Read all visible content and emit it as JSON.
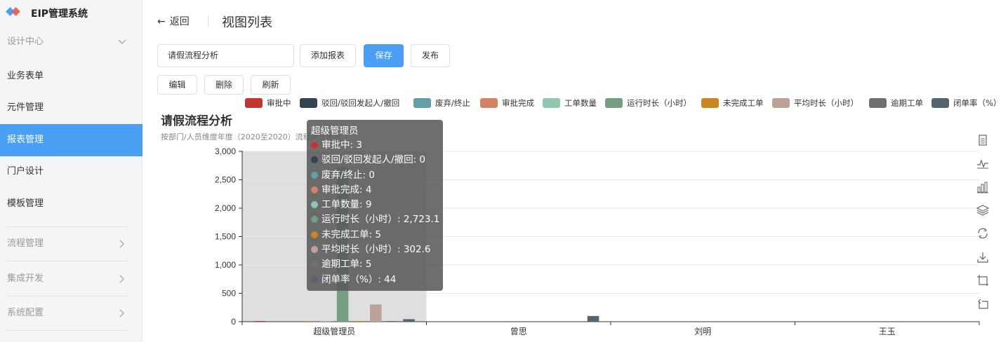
{
  "app": {
    "title": "EIP管理系统"
  },
  "sidebar": {
    "items": [
      {
        "label": "设计中心",
        "type": "group",
        "chevron": "chevron-down-icon"
      },
      {
        "label": "业务表单"
      },
      {
        "label": "元件管理"
      },
      {
        "label": "报表管理",
        "active": true
      },
      {
        "label": "门户设计"
      },
      {
        "label": "模板管理"
      },
      {
        "label": "流程管理",
        "type": "group",
        "chevron": "chevron-right-icon"
      },
      {
        "label": "集成开发",
        "type": "group",
        "chevron": "chevron-right-icon"
      },
      {
        "label": "系统配置",
        "type": "group",
        "chevron": "chevron-right-icon"
      }
    ]
  },
  "header": {
    "back_label": "返回",
    "title": "视图列表"
  },
  "toolbar": {
    "name_value": "请假流程分析",
    "add_report_label": "添加报表",
    "save_label": "保存",
    "publish_label": "发布",
    "edit_label": "编辑",
    "delete_label": "删除",
    "refresh_label": "刷新"
  },
  "colors": {
    "accent": "#4a9ff5"
  },
  "chart_data": {
    "type": "bar",
    "title": "请假流程分析",
    "subtitle": "按部门/人员维度年度（2020至2020）流程统计图表",
    "categories": [
      "超级管理员",
      "曾思",
      "刘明",
      "王玉"
    ],
    "ylim": [
      0,
      3000
    ],
    "yticks": [
      "0",
      "500",
      "1,000",
      "1,500",
      "2,000",
      "2,500",
      "3,000"
    ],
    "legend_position": "top",
    "series": [
      {
        "name": "审批中",
        "color": "#c23531",
        "values": [
          3,
          0,
          0,
          0
        ]
      },
      {
        "name": "驳回/驳回发起人/撤回",
        "color": "#2f4554",
        "values": [
          0,
          0,
          0,
          0
        ]
      },
      {
        "name": "废弃/终止",
        "color": "#61a0a8",
        "values": [
          0,
          0,
          0,
          0
        ]
      },
      {
        "name": "审批完成",
        "color": "#d48265",
        "values": [
          4,
          0,
          0,
          0
        ]
      },
      {
        "name": "工单数量",
        "color": "#91c7ae",
        "values": [
          9,
          0,
          0,
          0
        ]
      },
      {
        "name": "运行时长（小时）",
        "color": "#749f83",
        "values": [
          2723.1,
          0,
          0,
          0
        ]
      },
      {
        "name": "未完成工单",
        "color": "#ca8622",
        "values": [
          5,
          0,
          0,
          0
        ]
      },
      {
        "name": "平均时长（小时）",
        "color": "#bda29a",
        "values": [
          302.6,
          0,
          0,
          0
        ]
      },
      {
        "name": "逾期工单",
        "color": "#6e7074",
        "values": [
          5,
          0,
          0,
          0
        ]
      },
      {
        "name": "闭单率（%）",
        "color": "#546570",
        "values": [
          44,
          100,
          0,
          0
        ]
      }
    ],
    "tooltip": {
      "title": "超级管理员",
      "rows": [
        {
          "text": "审批中: 3",
          "color": "#c23531"
        },
        {
          "text": "驳回/驳回发起人/撤回: 0",
          "color": "#2f4554"
        },
        {
          "text": "废弃/终止: 0",
          "color": "#61a0a8"
        },
        {
          "text": "审批完成: 4",
          "color": "#d48265"
        },
        {
          "text": "工单数量: 9",
          "color": "#91c7ae"
        },
        {
          "text": "运行时长（小时）: 2,723.1",
          "color": "#749f83"
        },
        {
          "text": "未完成工单: 5",
          "color": "#ca8622"
        },
        {
          "text": "平均时长（小时）: 302.6",
          "color": "#bda29a"
        },
        {
          "text": "逾期工单: 5",
          "color": "#6e7074"
        },
        {
          "text": "闭单率（%）: 44",
          "color": "#546570"
        }
      ]
    }
  },
  "chart_tools": [
    "data-view-icon",
    "line-chart-icon",
    "bar-chart-icon",
    "stack-icon",
    "restore-icon",
    "download-icon",
    "zoom-icon",
    "zoom-reset-icon"
  ]
}
